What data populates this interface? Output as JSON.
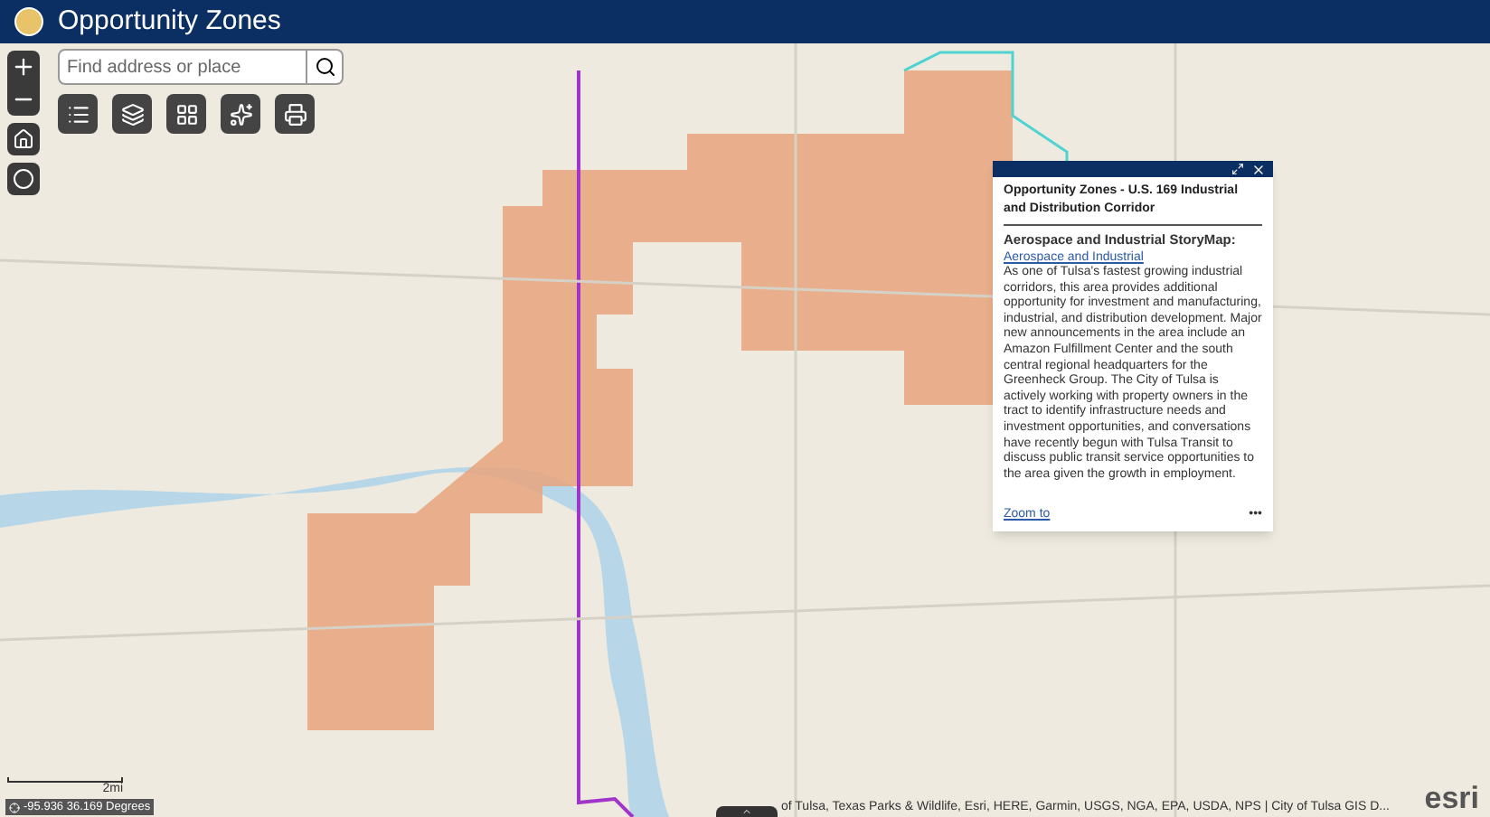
{
  "header": {
    "title": "Opportunity Zones"
  },
  "search": {
    "placeholder": "Find address or place"
  },
  "popup": {
    "title": "Opportunity Zones - U.S. 169 Industrial and Distribution Corridor",
    "heading": "Aerospace and Industrial StoryMap:",
    "link": "Aerospace and Industrial",
    "body": "As one of Tulsa's fastest growing industrial corridors, this area provides additional opportunity for investment and manufacturing, industrial, and distribution development. Major new announcements in the area include an Amazon Fulfillment Center and the south central regional headquarters for the Greenheck Group. The City of Tulsa is actively working with property owners in the tract to identify infrastructure needs and investment opportunities, and conversations have recently begun with Tulsa Transit to discuss public transit service opportunities to the area given the growth in employment.",
    "zoom_link": "Zoom to",
    "menu": "•••"
  },
  "scale": {
    "label": "2mi"
  },
  "coordinates": "-95.936 36.169 Degrees",
  "attribution": "of Tulsa, Texas Parks & Wildlife, Esri, HERE, Garmin, USGS, NGA, EPA, USDA, NPS | City of Tulsa GIS D...",
  "logo": "esri"
}
